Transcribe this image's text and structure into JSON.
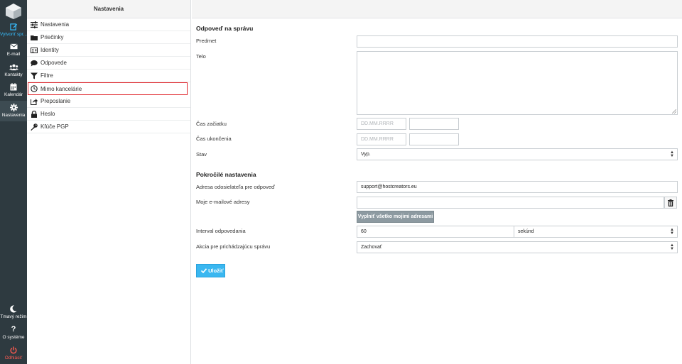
{
  "rail": {
    "compose": "Vytvoriť spr...",
    "email": "E-mail",
    "contacts": "Kontakty",
    "calendar": "Kalendár",
    "settings": "Nastavenia",
    "dark_mode": "Tmavý režim",
    "about": "O systéme",
    "logout": "Odhlásiť"
  },
  "settings_panel": {
    "title": "Nastavenia",
    "items": [
      {
        "label": "Nastavenia",
        "icon": "sliders-icon"
      },
      {
        "label": "Priečinky",
        "icon": "folder-icon"
      },
      {
        "label": "Identity",
        "icon": "id-card-icon"
      },
      {
        "label": "Odpovede",
        "icon": "comment-icon"
      },
      {
        "label": "Filtre",
        "icon": "filter-icon"
      },
      {
        "label": "Mimo kancelárie",
        "icon": "clock-icon",
        "selected": true
      },
      {
        "label": "Preposlanie",
        "icon": "forward-icon"
      },
      {
        "label": "Heslo",
        "icon": "lock-icon"
      },
      {
        "label": "Kľúče PGP",
        "icon": "key-icon"
      }
    ]
  },
  "form": {
    "section_reply": "Odpoveď na správu",
    "subject_label": "Predmet",
    "subject_value": "",
    "body_label": "Telo",
    "start_label": "Čas začiatku",
    "start_date_placeholder": "DD.MM.RRRR",
    "end_label": "Čas ukončenia",
    "end_date_placeholder": "DD.MM.RRRR",
    "status_label": "Stav",
    "status_value": "Vyp.",
    "section_advanced": "Pokročilé nastavenia",
    "sender_label": "Adresa odosielateľa pre odpoveď",
    "sender_value": "support@hostcreators.eu",
    "my_addresses_label": "Moje e-mailové adresy",
    "fill_button": "Vyplniť všetko mojimi adresami",
    "interval_label": "Interval odpovedania",
    "interval_value": "60",
    "interval_unit": "sekúnd",
    "action_label": "Akcia pre prichádzajúcu správu",
    "action_value": "Zachovať",
    "save_button": "Uložiť"
  },
  "colors": {
    "rail_bg": "#2e3a40",
    "accent": "#37beff",
    "selected_border": "#e0282e",
    "logout": "#ff5a50",
    "save_bg": "#3ab7f0"
  }
}
